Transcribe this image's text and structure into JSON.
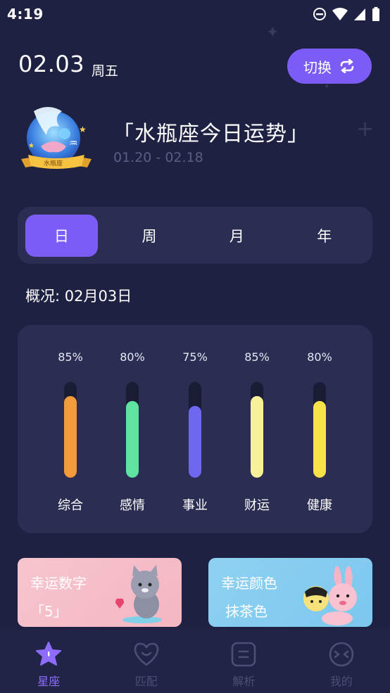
{
  "status_bar": {
    "time": "4:19"
  },
  "header": {
    "date": "02.03",
    "weekday": "周五",
    "switch_label": "切换"
  },
  "sign": {
    "title": "「水瓶座今日运势」",
    "range": "01.20 - 02.18",
    "ribbon": "水瓶座"
  },
  "period_tabs": [
    {
      "label": "日",
      "active": true
    },
    {
      "label": "周",
      "active": false
    },
    {
      "label": "月",
      "active": false
    },
    {
      "label": "年",
      "active": false
    }
  ],
  "overview": {
    "title": "概况: 02月03日",
    "bars": [
      {
        "name": "综合",
        "percent_label": "85%",
        "percent": 85,
        "color": "#f39a3b"
      },
      {
        "name": "感情",
        "percent_label": "80%",
        "percent": 80,
        "color": "#5fe3a0"
      },
      {
        "name": "事业",
        "percent_label": "75%",
        "percent": 75,
        "color": "#6e67f2"
      },
      {
        "name": "财运",
        "percent_label": "85%",
        "percent": 85,
        "color": "#f7f29a"
      },
      {
        "name": "健康",
        "percent_label": "80%",
        "percent": 80,
        "color": "#f8e24a"
      }
    ]
  },
  "lucky": {
    "number_title": "幸运数字",
    "number_value": "「5」",
    "color_title": "幸运颜色",
    "color_value": "抹茶色"
  },
  "bottom_nav": [
    {
      "label": "星座",
      "icon": "star-icon",
      "active": true
    },
    {
      "label": "匹配",
      "icon": "heart-icon",
      "active": false
    },
    {
      "label": "解析",
      "icon": "analysis-icon",
      "active": false
    },
    {
      "label": "我的",
      "icon": "profile-face-icon",
      "active": false
    }
  ],
  "colors": {
    "background": "#1e2142",
    "card": "#2b2e52",
    "accent": "#7b5cf5"
  }
}
